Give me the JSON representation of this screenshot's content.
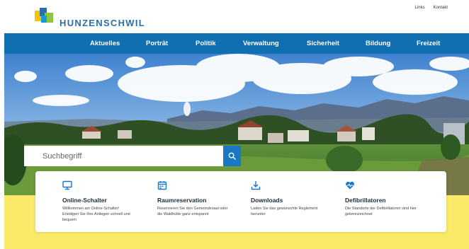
{
  "header": {
    "logo_text": "HUNZENSCHWIL",
    "utility_links": [
      "Links",
      "Kontakt"
    ]
  },
  "nav": {
    "items": [
      "Aktuelles",
      "Porträt",
      "Politik",
      "Verwaltung",
      "Sicherheit",
      "Bildung",
      "Freizeit"
    ]
  },
  "search": {
    "placeholder": "Suchbegriff"
  },
  "quick_links": [
    {
      "icon": "computer-icon",
      "title": "Online-Schalter",
      "desc": "Willkommen am Online-Schalter! Erledigen Sie Ihre Anliegen schnell und bequem"
    },
    {
      "icon": "calendar-icon",
      "title": "Raumreservation",
      "desc": "Reservieren Sie den Gemeindesaal oder die Waldhütte ganz entspannt"
    },
    {
      "icon": "download-icon",
      "title": "Downloads",
      "desc": "Laden Sie das gewünschte Reglement herunter"
    },
    {
      "icon": "heart-pulse-icon",
      "title": "Defibrillatoren",
      "desc": "Die Standorte der Defibrillatoren sind hier gekennzeichnet"
    }
  ],
  "colors": {
    "nav_blue": "#0f6fb0",
    "accent_blue": "#1a77c3",
    "yellow": "#fbe96a",
    "logo_green": "#8cc63f"
  }
}
